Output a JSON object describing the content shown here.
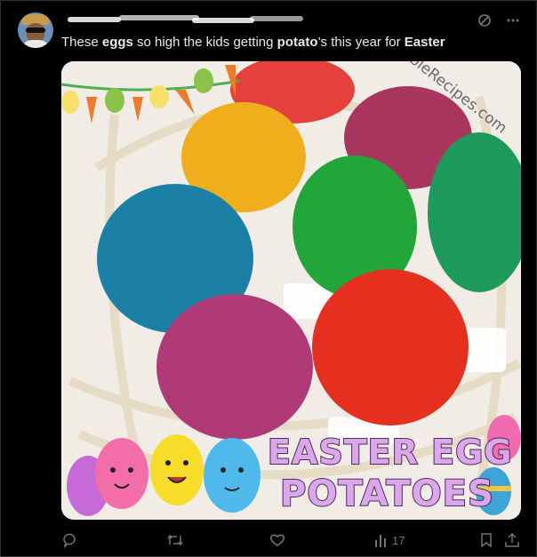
{
  "post": {
    "text_parts": [
      {
        "text": "These ",
        "bold": false
      },
      {
        "text": "eggs",
        "bold": true
      },
      {
        "text": " so high the kids getting ",
        "bold": false
      },
      {
        "text": "potato",
        "bold": true
      },
      {
        "text": "’s this year for ",
        "bold": false
      },
      {
        "text": "Easter",
        "bold": true
      }
    ]
  },
  "image": {
    "watermark": "MyIncredibleRecipes.com",
    "overlay_line1": "EASTER EGG",
    "overlay_line2": "POTATOES"
  },
  "top_icons": [
    "grok-icon",
    "more-icon"
  ],
  "actions": {
    "reply": "",
    "repost": "",
    "like": "",
    "views": "17"
  },
  "colors": {
    "background": "#000000",
    "text": "#e7e9ea",
    "muted": "#71767b",
    "border": "#2f3336"
  }
}
